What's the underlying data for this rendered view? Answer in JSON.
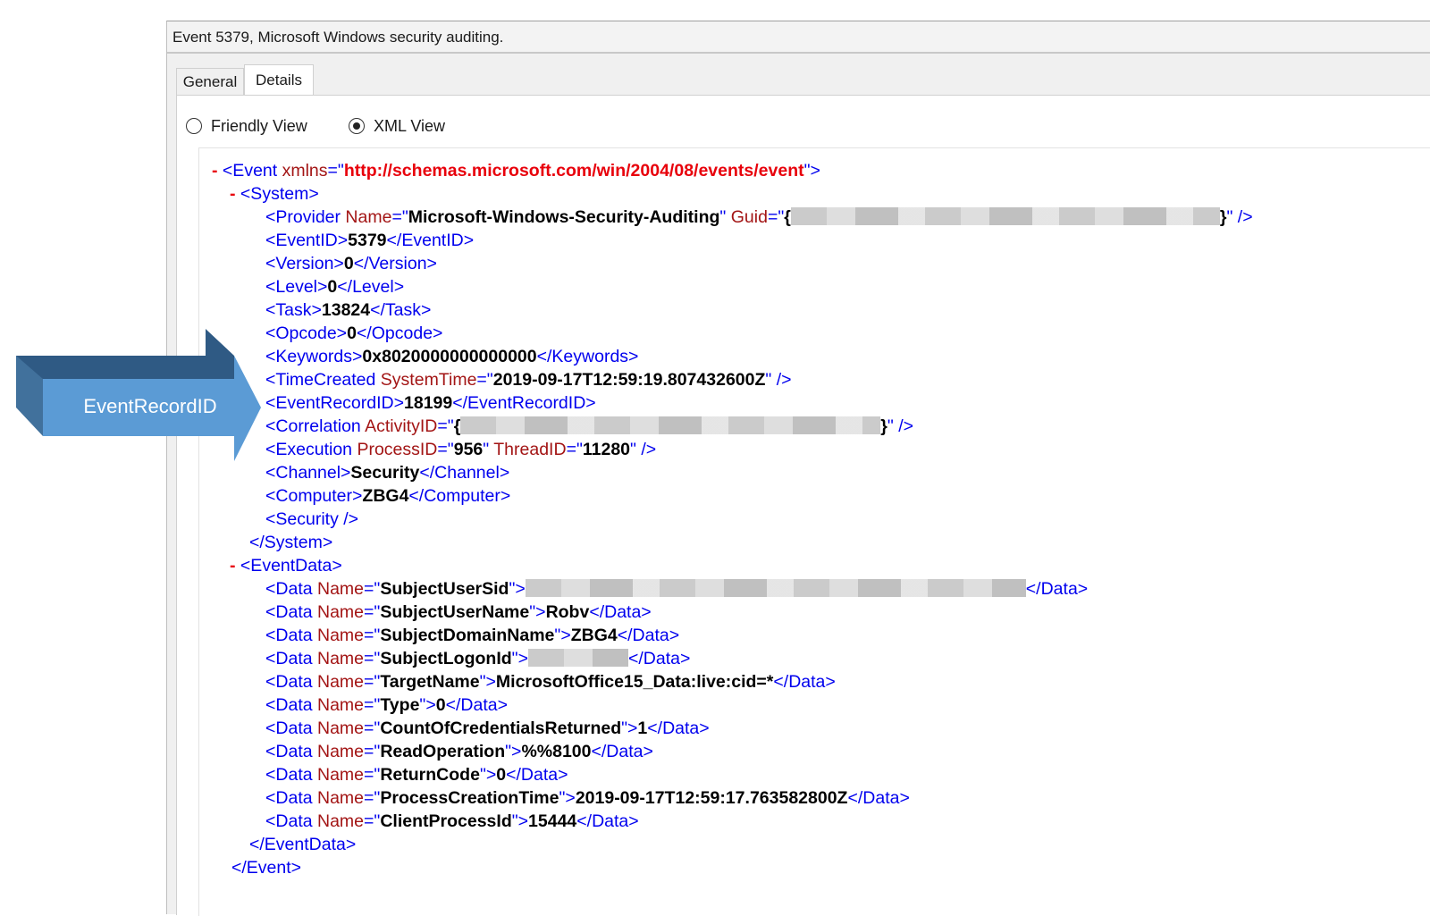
{
  "window": {
    "title": "Event 5379, Microsoft Windows security auditing."
  },
  "tabs": [
    {
      "label": "General",
      "selected": false
    },
    {
      "label": "Details",
      "selected": true
    }
  ],
  "view_mode": {
    "options": [
      {
        "label": "Friendly View",
        "selected": false
      },
      {
        "label": "XML View",
        "selected": true
      }
    ]
  },
  "callout": {
    "label": "EventRecordID",
    "colors": {
      "front": "#5b9bd5",
      "side": "#41719c",
      "back": "#2f5a84"
    }
  },
  "colors": {
    "tag": "#0000ee",
    "attr": "#a31515",
    "string": "#e8000b",
    "value": "#000000",
    "collapse": "#e8000b"
  },
  "xml": {
    "collapse_glyph": "-",
    "event_open": "<Event ",
    "event_xmlns_attr": "xmlns",
    "eq": "=\"",
    "quote_close": "\">",
    "event_xmlns": "http://schemas.microsoft.com/win/2004/08/events/event",
    "system_open": "<System>",
    "provider": {
      "open": "<Provider ",
      "name_attr": "Name",
      "name": "Microsoft-Windows-Security-Auditing",
      "guid_attr": "Guid",
      "guid_prefix": "{",
      "guid_suffix": "}",
      "close": "\" />"
    },
    "eventid": {
      "open": "<EventID>",
      "value": "5379",
      "close": "</EventID>"
    },
    "version": {
      "open": "<Version>",
      "value": "0",
      "close": "</Version>"
    },
    "level": {
      "open": "<Level>",
      "value": "0",
      "close": "</Level>"
    },
    "task": {
      "open": "<Task>",
      "value": "13824",
      "close": "</Task>"
    },
    "opcode": {
      "open": "<Opcode>",
      "value": "0",
      "close": "</Opcode>"
    },
    "keywords": {
      "open": "<Keywords>",
      "value": "0x8020000000000000",
      "close": "</Keywords>"
    },
    "timecreated": {
      "open": "<TimeCreated ",
      "attr": "SystemTime",
      "value": "2019-09-17T12:59:19.807432600Z",
      "close": "\" />"
    },
    "eventrecordid": {
      "open": "<EventRecordID>",
      "value": "18199",
      "close": "</EventRecordID>"
    },
    "correlation": {
      "open": "<Correlation ",
      "attr": "ActivityID",
      "prefix": "{",
      "suffix": "}",
      "close": "\" />"
    },
    "execution": {
      "open": "<Execution ",
      "pid_attr": "ProcessID",
      "pid": "956",
      "mid": "\" ",
      "tid_attr": "ThreadID",
      "tid": "11280",
      "close": "\" />"
    },
    "channel": {
      "open": "<Channel>",
      "value": "Security",
      "close": "</Channel>"
    },
    "computer": {
      "open": "<Computer>",
      "value": "ZBG4",
      "close": "</Computer>"
    },
    "security": {
      "tag": "<Security />"
    },
    "system_close": "</System>",
    "eventdata_open": "<EventData>",
    "data_open": "<Data ",
    "data_name_attr": "Name",
    "data_close": "</Data>",
    "data_items": [
      {
        "name": "SubjectUserSid",
        "value": ""
      },
      {
        "name": "SubjectUserName",
        "value": "Robv"
      },
      {
        "name": "SubjectDomainName",
        "value": "ZBG4"
      },
      {
        "name": "SubjectLogonId",
        "value": ""
      },
      {
        "name": "TargetName",
        "value": "MicrosoftOffice15_Data:live:cid=*"
      },
      {
        "name": "Type",
        "value": "0"
      },
      {
        "name": "CountOfCredentialsReturned",
        "value": "1"
      },
      {
        "name": "ReadOperation",
        "value": "%%8100"
      },
      {
        "name": "ReturnCode",
        "value": "0"
      },
      {
        "name": "ProcessCreationTime",
        "value": "2019-09-17T12:59:17.763582800Z"
      },
      {
        "name": "ClientProcessId",
        "value": "15444"
      }
    ],
    "eventdata_close": "</EventData>",
    "event_close": "</Event>"
  }
}
